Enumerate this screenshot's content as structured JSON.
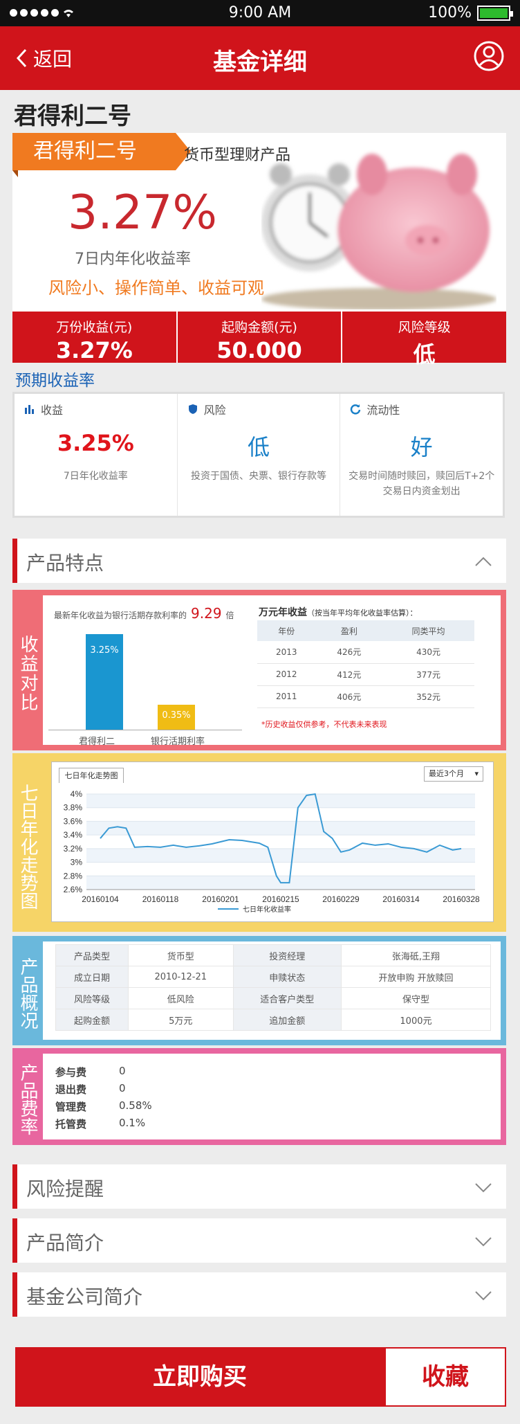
{
  "status": {
    "time": "9:00  AM",
    "battery": "100%",
    "battery_level": 1.0
  },
  "nav": {
    "back_label": "返回",
    "title": "基金详细"
  },
  "fund_name": "君得利二号",
  "banner": {
    "tag": "君得利二号",
    "subtitle": "货币型理财产品",
    "rate": "3.27%",
    "rate_label": "7日内年化收益率",
    "slogan": "风险小、操作简单、收益可观"
  },
  "stats": [
    {
      "label": "万份收益(元)",
      "value": "3.27%"
    },
    {
      "label": "起购金额(元)",
      "value": "50.000"
    },
    {
      "label": "风险等级",
      "value": "低"
    }
  ],
  "expected": {
    "heading": "预期收益率",
    "cols": [
      {
        "title": "收益",
        "icon": "bar-chart-icon",
        "value": "3.25%",
        "color": "#e0141b",
        "desc": "7日年化收益率"
      },
      {
        "title": "风险",
        "icon": "shield-icon",
        "value": "低",
        "color": "#1a80c8",
        "desc": "投资于国债、央票、银行存款等"
      },
      {
        "title": "流动性",
        "icon": "refresh-icon",
        "value": "好",
        "color": "#1a80c8",
        "desc": "交易时间随时赎回，赎回后T+2个交易日内资金划出"
      }
    ]
  },
  "features": {
    "heading": "产品特点",
    "compare": {
      "side_label": "收益对比",
      "note_pre": "最新年化收益为银行活期存款利率的",
      "multiple": "9.29",
      "note_post": "倍",
      "bar_fund_label": "君得利二",
      "bar_fund_value": "3.25%",
      "bar_bank_label": "银行活期利率",
      "bar_bank_value": "0.35%",
      "table_title": "万元年收益",
      "table_note": "（按当年平均年化收益率估算）：",
      "headers": [
        "年份",
        "盈利",
        "同类平均"
      ],
      "rows": [
        [
          "2013",
          "426元",
          "430元"
        ],
        [
          "2012",
          "412元",
          "377元"
        ],
        [
          "2011",
          "406元",
          "352元"
        ]
      ],
      "warning": "*历史收益仅供参考，不代表未来表现"
    },
    "trend": {
      "side_label": "七日年化走势图",
      "tab_label": "七日年化走势图",
      "range_select": "最近3个月"
    },
    "overview": {
      "side_label": "产品概况",
      "rows": [
        [
          "产品类型",
          "货币型",
          "投资经理",
          "张海砥,王翔"
        ],
        [
          "成立日期",
          "2010-12-21",
          "申赎状态",
          "开放申购 开放赎回"
        ],
        [
          "风险等级",
          "低风险",
          "适合客户类型",
          "保守型"
        ],
        [
          "起购金额",
          "5万元",
          "追加金额",
          "1000元"
        ]
      ]
    },
    "fees": {
      "side_label": "产品费率",
      "items": [
        {
          "k": "参与费",
          "v": "0"
        },
        {
          "k": "退出费",
          "v": "0"
        },
        {
          "k": "管理费",
          "v": "0.58%"
        },
        {
          "k": "托管费",
          "v": "0.1%"
        }
      ]
    }
  },
  "sections": [
    "风险提醒",
    "产品简介",
    "基金公司简介"
  ],
  "actions": {
    "buy": "立即购买",
    "favorite": "收藏"
  },
  "chart_data": {
    "type": "line",
    "title": "",
    "xlabel": "",
    "ylabel": "",
    "ylim": [
      2.6,
      4.0
    ],
    "yticks": [
      "4%",
      "3.8%",
      "3.6%",
      "3.4%",
      "3.2%",
      "3%",
      "2.8%",
      "2.6%"
    ],
    "xticks": [
      "20160104",
      "20160118",
      "20160201",
      "20160215",
      "20160229",
      "20160314",
      "20160328"
    ],
    "series": [
      {
        "name": "七日年化收益率",
        "x": [
          "20160104",
          "20160106",
          "20160108",
          "20160110",
          "20160112",
          "20160115",
          "20160118",
          "20160121",
          "20160124",
          "20160127",
          "20160130",
          "20160201",
          "20160203",
          "20160206",
          "20160208",
          "20160210",
          "20160212",
          "20160214",
          "20160215",
          "20160217",
          "20160219",
          "20160221",
          "20160223",
          "20160225",
          "20160227",
          "20160229",
          "20160302",
          "20160305",
          "20160308",
          "20160311",
          "20160314",
          "20160317",
          "20160320",
          "20160323",
          "20160326",
          "20160328"
        ],
        "values": [
          3.35,
          3.5,
          3.52,
          3.5,
          3.22,
          3.23,
          3.22,
          3.25,
          3.22,
          3.24,
          3.27,
          3.3,
          3.33,
          3.32,
          3.3,
          3.28,
          3.22,
          2.8,
          2.7,
          2.7,
          3.8,
          3.98,
          4.0,
          3.45,
          3.35,
          3.15,
          3.18,
          3.28,
          3.25,
          3.27,
          3.22,
          3.2,
          3.15,
          3.25,
          3.18,
          3.2
        ]
      }
    ],
    "legend": "bottom"
  }
}
